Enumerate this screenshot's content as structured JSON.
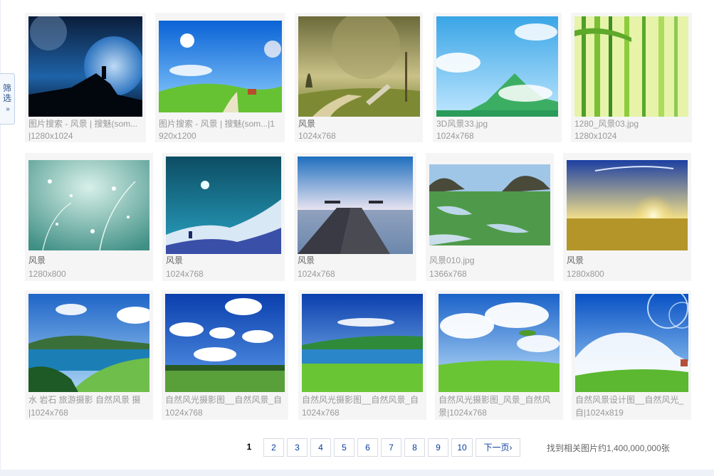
{
  "filter_tab": {
    "line1": "筛",
    "line2": "选",
    "arrow": "»"
  },
  "rows": [
    [
      {
        "caption": "图片搜索  - 风景  | 搜魅(som...",
        "size": "|1280x1024"
      },
      {
        "caption": "图片搜索  - 风景  | 搜魅(som...|1",
        "size": "920x1200"
      },
      {
        "caption": "风景",
        "size": "1024x768"
      },
      {
        "caption": "3D风景33.jpg",
        "size": "1024x768"
      },
      {
        "caption": "1280_风景03.jpg",
        "size": "1280x1024"
      }
    ],
    [
      {
        "caption": "风景",
        "size": "1280x800"
      },
      {
        "caption": "风景",
        "size": "1024x768"
      },
      {
        "caption": "风景",
        "size": "1024x768"
      },
      {
        "caption": "风景010.jpg",
        "size": "1366x768"
      },
      {
        "caption": "风景",
        "size": "1280x800"
      }
    ],
    [
      {
        "caption": "水  岩石  旅游摄影  自然风景  摄",
        "size": "|1024x768"
      },
      {
        "caption": "自然风光摄影图__自然风景_自",
        "size": "1024x768"
      },
      {
        "caption": "自然风光摄影图__自然风景_自",
        "size": "1024x768"
      },
      {
        "caption": "自然风光摄影图_风景_自然风",
        "size": "景|1024x768"
      },
      {
        "caption": "自然风景设计图__自然风光_",
        "size": "自|1024x819"
      }
    ]
  ],
  "pagination": {
    "current": "1",
    "pages": [
      "2",
      "3",
      "4",
      "5",
      "6",
      "7",
      "8",
      "9",
      "10"
    ],
    "next_label": "下一页›"
  },
  "result_count": "找到相关图片约1,400,000,000张"
}
